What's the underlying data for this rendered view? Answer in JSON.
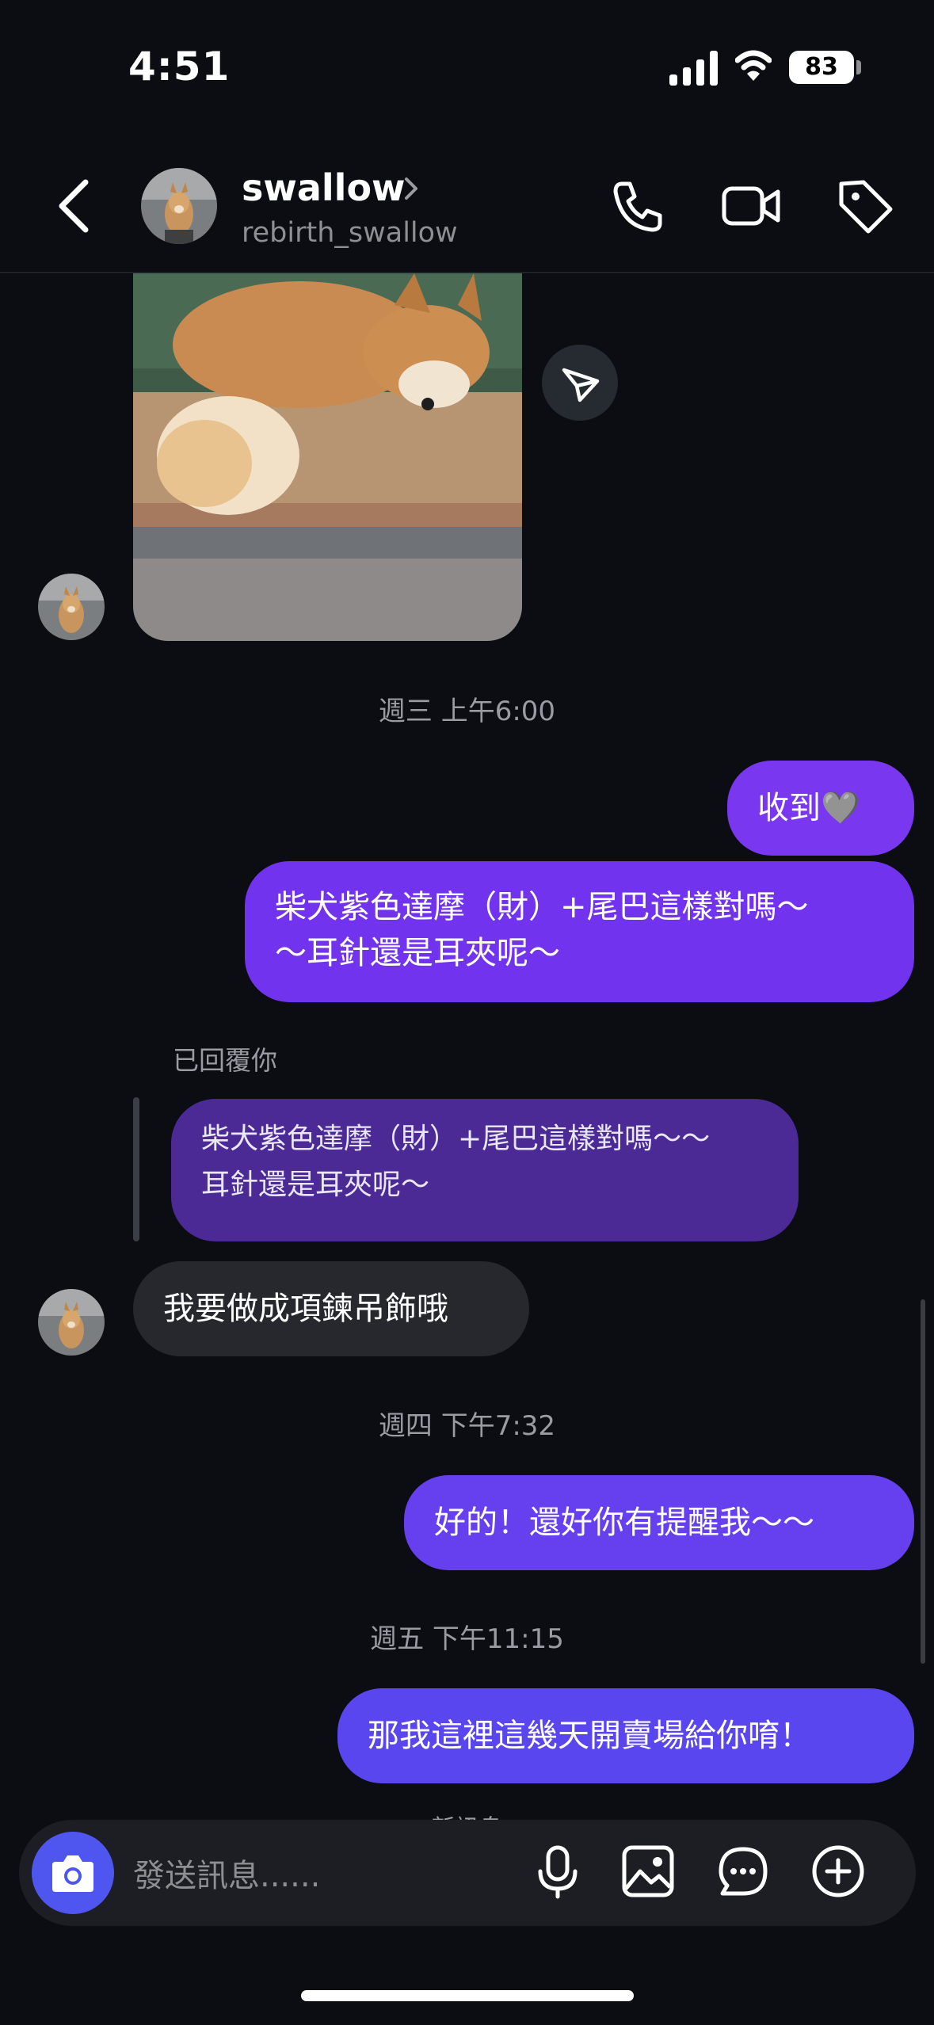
{
  "status_bar": {
    "time": "4:51",
    "battery": "83"
  },
  "header": {
    "name": "swallow",
    "username": "rebirth_swallow",
    "icons": [
      "back-icon",
      "phone-icon",
      "video-icon",
      "tag-icon"
    ]
  },
  "messages": {
    "ts1": "週三 上午6:00",
    "out1": "收到🩶",
    "out2_line1": "柴犬紫色達摩（財）+尾巴這樣對嗎～",
    "out2_line2": "～耳針還是耳夾呢～",
    "replied_label": "已回覆你",
    "reply_line1": "柴犬紫色達摩（財）+尾巴這樣對嗎～～",
    "reply_line2": "耳針還是耳夾呢～",
    "in1": "我要做成項鍊吊飾哦",
    "ts2": "週四 下午7:32",
    "out3": "好的！還好你有提醒我～～",
    "ts3": "週五 下午11:15",
    "out4": "那我這裡這幾天開賣場給你唷！",
    "new_messages": "新訊息"
  },
  "composer": {
    "placeholder": "發送訊息......"
  },
  "colors": {
    "bubble_purple": "#7a37f0",
    "bubble_violet": "#5a46ee",
    "camera": "#4f56f0"
  }
}
